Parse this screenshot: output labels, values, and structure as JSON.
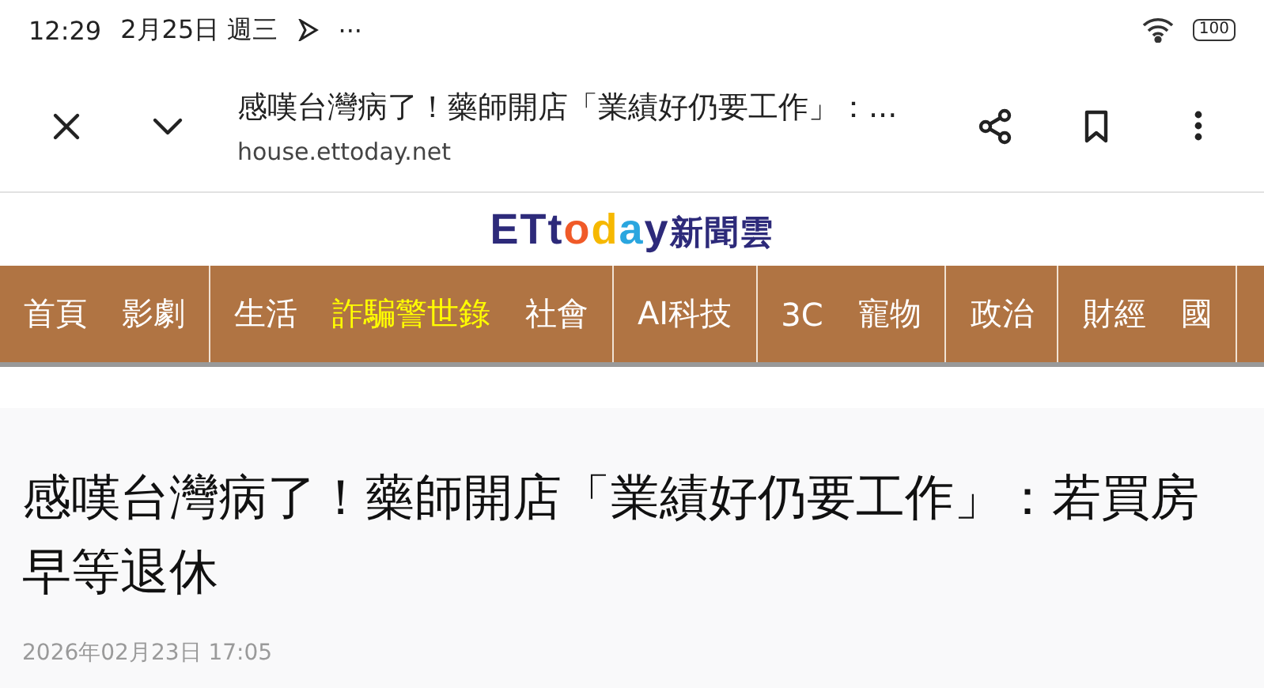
{
  "status_bar": {
    "time": "12:29",
    "date": "2月25日 週三",
    "more": "···",
    "battery": "100"
  },
  "toolbar": {
    "title": "感嘆台灣病了！藥師開店「業績好仍要工作」：...",
    "url": "house.ettoday.net"
  },
  "logo": {
    "text": "ETtoday",
    "suffix": "新聞雲"
  },
  "nav": {
    "groups": [
      {
        "items": [
          {
            "label": "首頁",
            "highlight": false
          },
          {
            "label": "影劇",
            "highlight": false
          }
        ]
      },
      {
        "items": [
          {
            "label": "生活",
            "highlight": false
          },
          {
            "label": "詐騙警世錄",
            "highlight": true
          },
          {
            "label": "社會",
            "highlight": false
          }
        ]
      },
      {
        "items": [
          {
            "label": "AI科技",
            "highlight": false
          }
        ]
      },
      {
        "items": [
          {
            "label": "3C",
            "highlight": false
          },
          {
            "label": "寵物",
            "highlight": false
          }
        ]
      },
      {
        "items": [
          {
            "label": "政治",
            "highlight": false
          }
        ]
      },
      {
        "items": [
          {
            "label": "財經",
            "highlight": false
          },
          {
            "label": "國",
            "highlight": false
          }
        ]
      }
    ]
  },
  "article": {
    "title": "感嘆台灣病了！藥師開店「業績好仍要工作」：若買房早等退休",
    "date": "2026年02月23日 17:05"
  }
}
